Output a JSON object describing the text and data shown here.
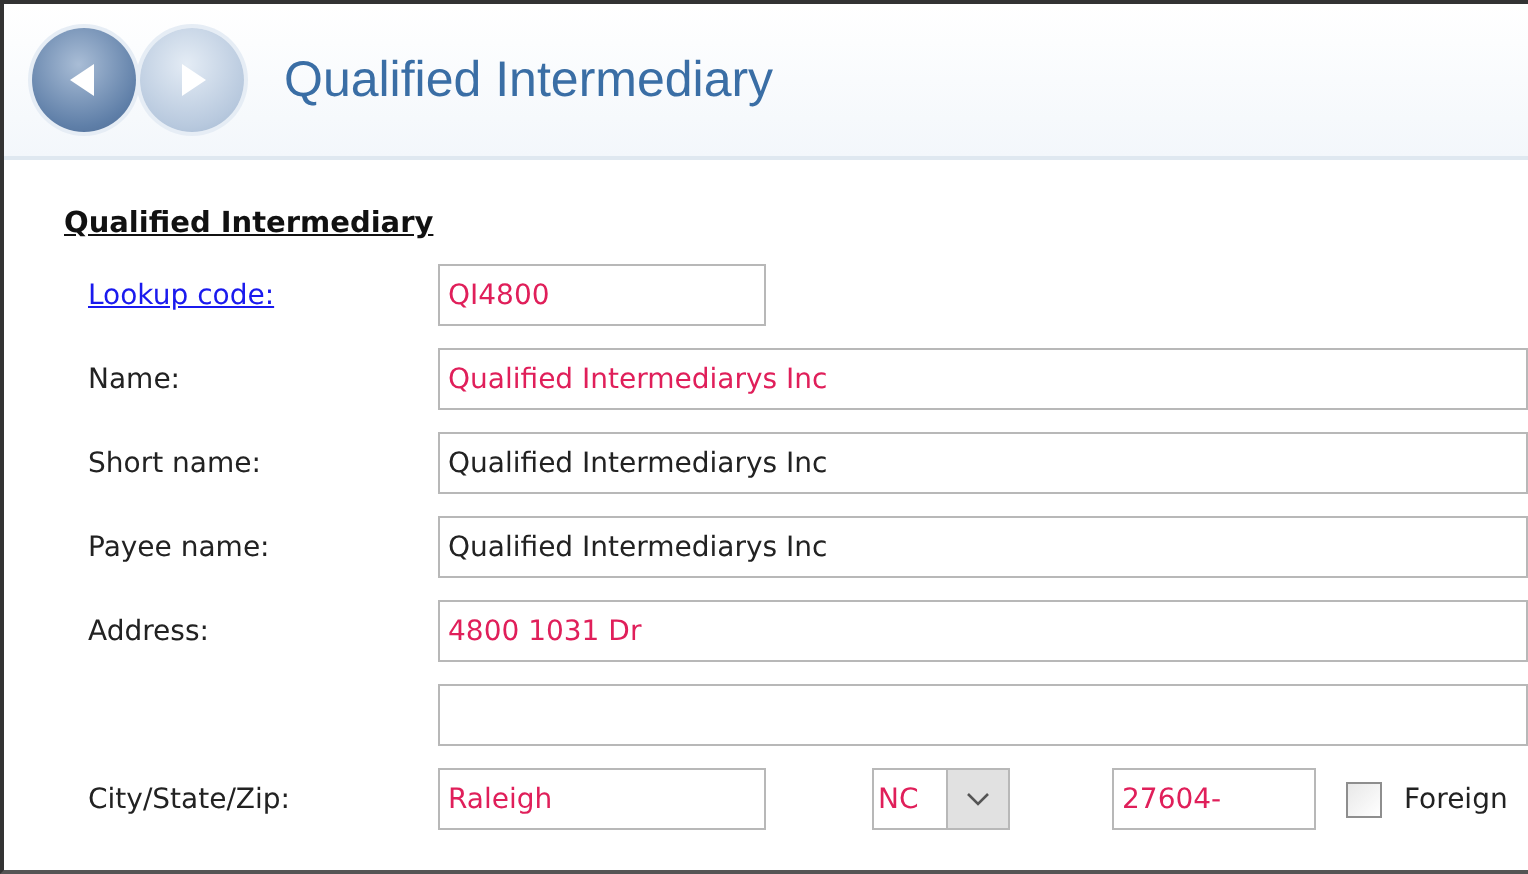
{
  "header": {
    "title": "Qualified Intermediary",
    "nav": [
      {
        "kind": "back",
        "disabled": false
      },
      {
        "kind": "forward",
        "disabled": true
      }
    ]
  },
  "section": {
    "title": "Qualified Intermediary",
    "rows": [
      {
        "label": "Lookup code:",
        "kind": "link",
        "fields": [
          {
            "kind": "short-text",
            "value": "QI4800",
            "required": true
          }
        ]
      },
      {
        "label": "Name:",
        "kind": "plain",
        "fields": [
          {
            "kind": "text",
            "value": "Qualified Intermediarys Inc",
            "required": true
          }
        ]
      },
      {
        "label": "Short name:",
        "kind": "plain",
        "fields": [
          {
            "kind": "text",
            "value": "Qualified Intermediarys Inc",
            "required": false
          }
        ]
      },
      {
        "label": "Payee name:",
        "kind": "plain",
        "fields": [
          {
            "kind": "text",
            "value": "Qualified Intermediarys Inc",
            "required": false
          }
        ]
      },
      {
        "label": "Address:",
        "kind": "plain",
        "fields": [
          {
            "kind": "text",
            "value": "4800 1031 Dr",
            "required": true
          }
        ]
      },
      {
        "fields": [
          {
            "kind": "text"
          }
        ]
      },
      {
        "label": "City/State/Zip:",
        "kind": "plain",
        "fields": [
          {
            "kind": "short-text",
            "value": "Raleigh",
            "required": true
          },
          {
            "kind": "select",
            "value": "NC",
            "required": true
          },
          {
            "kind": "zip",
            "value": "27604-",
            "required": true
          },
          {
            "kind": "checkbox",
            "label": "Foreign",
            "checked": false
          }
        ]
      }
    ]
  }
}
